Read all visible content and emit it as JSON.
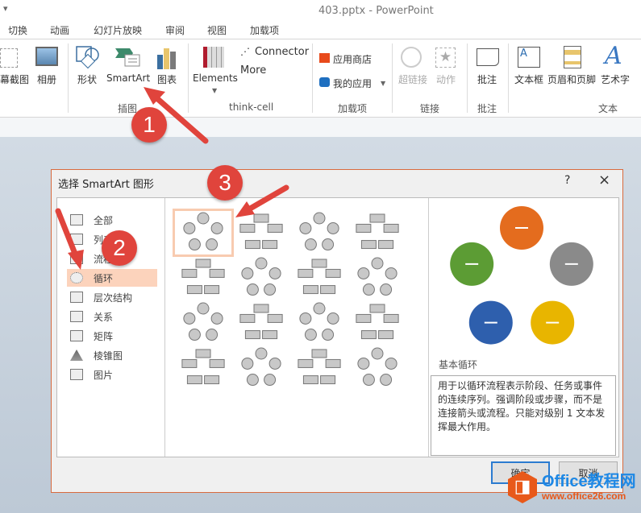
{
  "window": {
    "title": "403.pptx - PowerPoint"
  },
  "tabs": [
    "切换",
    "动画",
    "幻灯片放映",
    "审阅",
    "视图",
    "加载项"
  ],
  "ribbon": {
    "buttons": {
      "screenshot": "幕截图",
      "album": "相册",
      "shapes": "形状",
      "smartart": "SmartArt",
      "chart": "图表",
      "elements": "Elements",
      "connector": "Connector",
      "more": "More",
      "store": "应用商店",
      "myapps": "我的应用",
      "hyperlink": "超链接",
      "action": "动作",
      "comment": "批注",
      "textbox": "文本框",
      "headerfooter": "页眉和页脚",
      "wordart": "艺术字"
    },
    "groups": {
      "illustrations": "插图",
      "thinkcell": "think-cell",
      "addins": "加载项",
      "links": "链接",
      "comments": "批注",
      "text": "文本"
    }
  },
  "dialog": {
    "title": "选择 SmartArt 图形",
    "help": "?",
    "close": "×",
    "categories": [
      "全部",
      "列表",
      "流程",
      "循环",
      "层次结构",
      "关系",
      "矩阵",
      "棱锥图",
      "图片"
    ],
    "selected_category": "循环",
    "preview": {
      "name": "基本循环",
      "description": "用于以循环流程表示阶段、任务或事件的连续序列。强调阶段或步骤，而不是连接箭头或流程。只能对级别 1 文本发挥最大作用。",
      "colors": [
        "#e46c1e",
        "#8a8a8a",
        "#e8b500",
        "#2e5fad",
        "#5c9c34"
      ]
    },
    "ok": "确定",
    "cancel": "取消"
  },
  "annotations": [
    "1",
    "2",
    "3"
  ],
  "watermark": {
    "brand": "Office教程网",
    "url": "www.office26.com"
  }
}
